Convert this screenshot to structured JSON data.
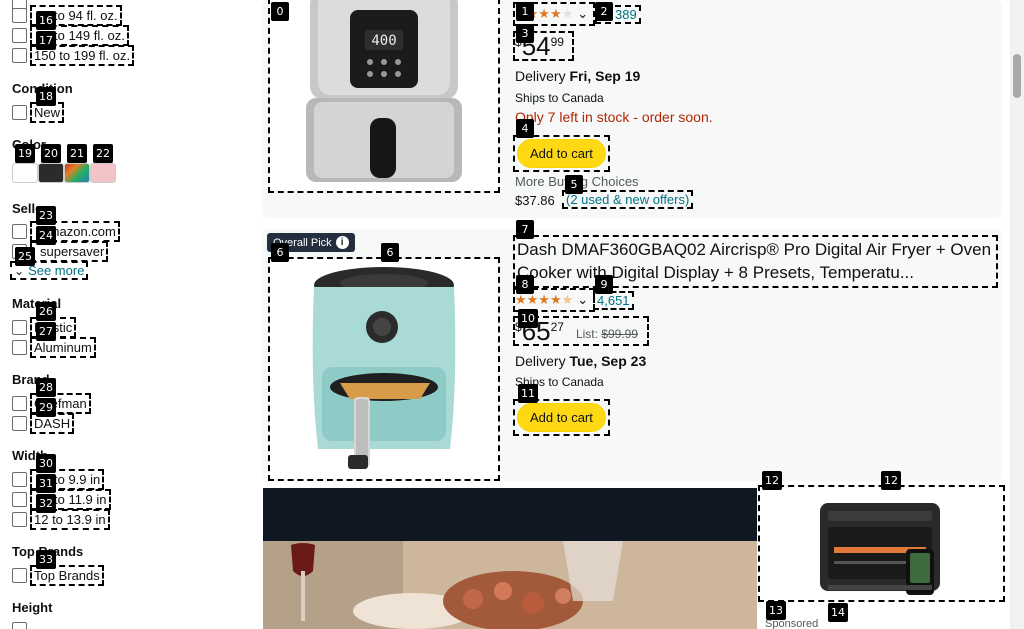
{
  "sidebar": {
    "size_options": [
      "? to 94 fl. oz.",
      "? to 149 fl. oz.",
      "150 to 199 fl. oz."
    ],
    "size_labels": [
      "to 94 fl. oz.",
      "to 149 fl. oz.",
      "150 to 199 fl. oz."
    ],
    "condition_title": "Condition",
    "condition_new": "New",
    "color_title": "Color",
    "colors": [
      "#ffffff",
      "#2b2b2b",
      "#b5603c",
      "#f4c3c8"
    ],
    "seller_title": "Seller",
    "sellers": [
      "Amazon.com",
      "supersaver"
    ],
    "see_more": "See more",
    "material_title": "Material",
    "materials": [
      "Plastic",
      "Aluminum"
    ],
    "brand_title": "Brand",
    "brands": [
      "Chefman",
      "DASH"
    ],
    "width_title": "Width",
    "widths": [
      "to 9.9 in",
      "to 11.9 in",
      "12 to 13.9 in"
    ],
    "top_brands_title": "Top Brands",
    "top_brands": "Top Brands",
    "height_title": "Height"
  },
  "product1": {
    "rating_count": "389",
    "price_sym": "$",
    "price_whole": "54",
    "price_frac": "99",
    "delivery_label": "Delivery ",
    "delivery_date": "Fri, Sep 19",
    "ships": "Ships to Canada",
    "stock": "Only 7 left in stock - order soon.",
    "add_to_cart": "Add to cart",
    "more_buying": "More Buying Choices",
    "alt_price": "$37.86",
    "used_link": "(2 used & new offers)"
  },
  "product2": {
    "badge": "Overall Pick",
    "title": "Dash DMAF360GBAQ02 Aircrisp® Pro Digital Air Fryer + Oven Cooker with Digital Display + 8 Presets, Temperatu...",
    "rating_count": "4,651",
    "price_sym": "$",
    "price_whole": "65",
    "price_frac": "27",
    "list_label": "List: ",
    "list_price": "$99.99",
    "delivery_label": "Delivery ",
    "delivery_date": "Tue, Sep 23",
    "ships": "Ships to Canada",
    "add_to_cart": "Add to cart"
  },
  "sponsored": {
    "label": "Sponsored"
  },
  "markers": [
    "0",
    "1",
    "2",
    "3",
    "4",
    "5",
    "6",
    "7",
    "8",
    "9",
    "10",
    "11",
    "12",
    "13",
    "14",
    "16",
    "17",
    "18",
    "19",
    "20",
    "21",
    "22",
    "23",
    "24",
    "25",
    "26",
    "27",
    "28",
    "29",
    "30",
    "31",
    "32",
    "33"
  ],
  "colors_theme": {
    "link": "#007185",
    "stock_red": "#b12704",
    "cart_yellow": "#ffd814",
    "star_orange": "#de7921"
  }
}
